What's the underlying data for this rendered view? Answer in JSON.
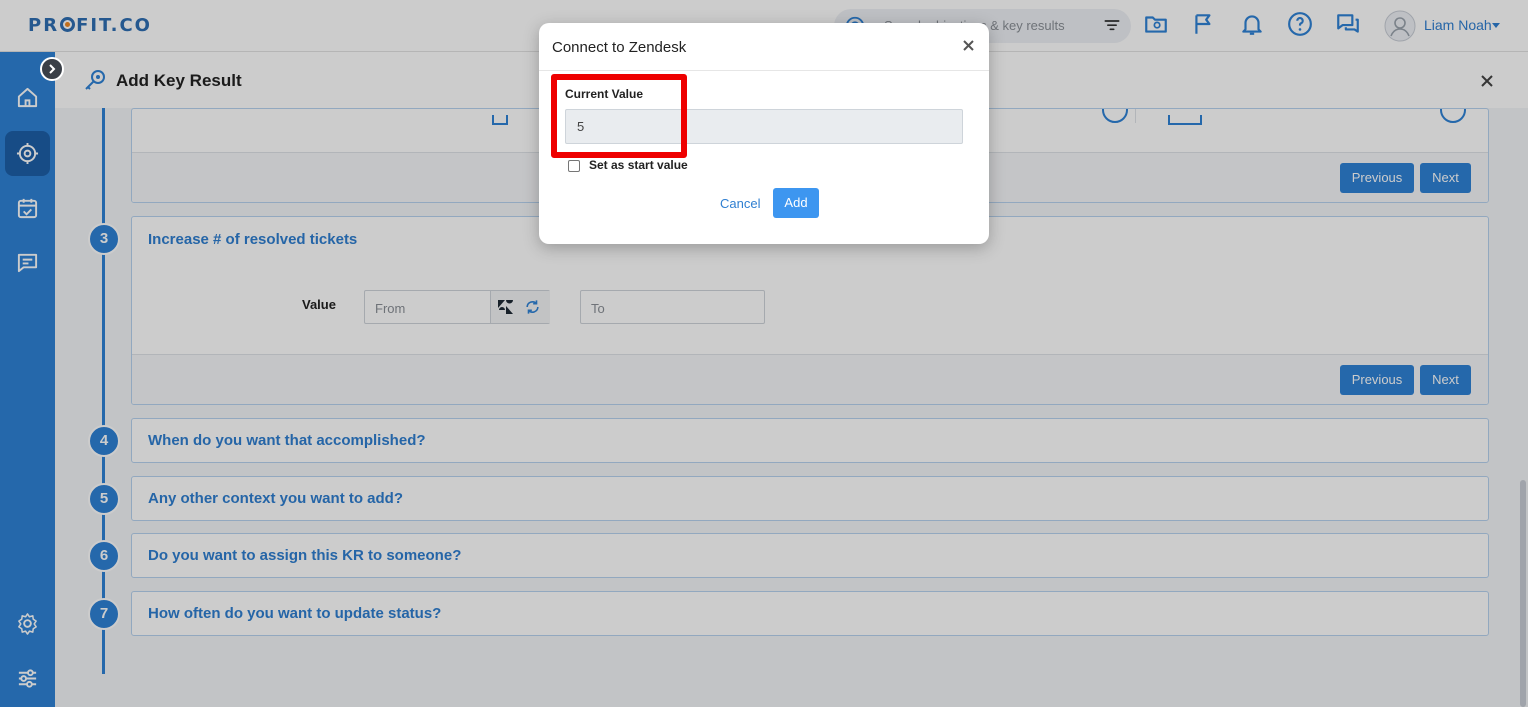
{
  "brand": {
    "logo": "PROFIT.CO",
    "accent": "#2f82d6",
    "highlight": "#ee0000"
  },
  "topbar": {
    "search_placeholder": "Search objectives & key results",
    "icons": [
      "search-icon",
      "filter-icon",
      "folder-icon",
      "flag-icon",
      "bell-icon",
      "help-icon",
      "chat-icon"
    ],
    "user_name": "Liam Noah"
  },
  "sidebar": {
    "items": [
      "home-icon",
      "target-icon",
      "calendar-check-icon",
      "chat-icon",
      "gear-icon",
      "sliders-icon"
    ]
  },
  "page": {
    "title": "Add Key Result"
  },
  "step2": {
    "previous": "Previous",
    "next": "Next"
  },
  "step3": {
    "number": "3",
    "title": "Increase # of resolved tickets",
    "value_label": "Value",
    "from_placeholder": "From",
    "to_placeholder": "To",
    "previous": "Previous",
    "next": "Next"
  },
  "steps": [
    {
      "number": "4",
      "title": "When do you want that accomplished?"
    },
    {
      "number": "5",
      "title": "Any other context you want to add?"
    },
    {
      "number": "6",
      "title": "Do you want to assign this KR to someone?"
    },
    {
      "number": "7",
      "title": "How often do you want to update status?"
    }
  ],
  "modal": {
    "title": "Connect to Zendesk",
    "current_value_label": "Current Value",
    "current_value": "5",
    "checkbox_label": "Set as start value",
    "checkbox_checked": false,
    "cancel": "Cancel",
    "add": "Add"
  }
}
